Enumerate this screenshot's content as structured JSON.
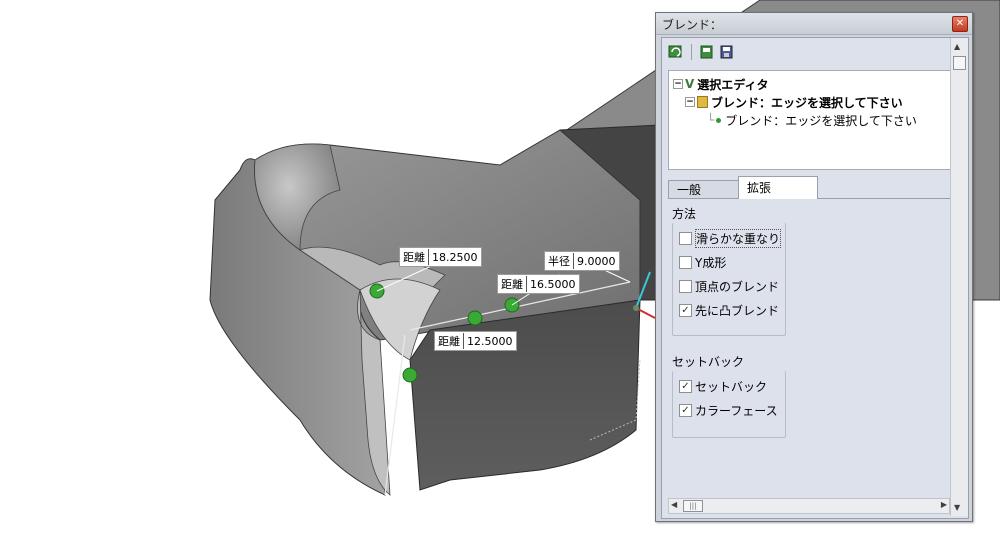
{
  "viewport": {
    "dimension_labels": [
      {
        "label": "距離",
        "value": "18.2500"
      },
      {
        "label": "半径",
        "value": "9.0000"
      },
      {
        "label": "距離",
        "value": "16.5000"
      },
      {
        "label": "距離",
        "value": "12.5000"
      }
    ]
  },
  "panel": {
    "title": "ブレンド：",
    "close_glyph": "✕",
    "toolbar": {
      "icons": [
        "refresh-icon",
        "new-icon",
        "save-icon"
      ]
    },
    "tree": {
      "root": {
        "label": "選択エディタ",
        "icon": "selection-editor-icon"
      },
      "child": {
        "label": "ブレンド：エッジを選択して下さい",
        "icon": "blend-folder-icon"
      },
      "leaf": {
        "label": "ブレンド：エッジを選択して下さい",
        "icon": "green-dot-icon"
      }
    },
    "tabs": [
      "一般",
      "拡張"
    ],
    "active_tab": "拡張",
    "method_group": {
      "title": "方法",
      "options": [
        {
          "label": "滑らかな重なり",
          "checked": false
        },
        {
          "label": "Y成形",
          "checked": false
        },
        {
          "label": "頂点のブレンド",
          "checked": false
        },
        {
          "label": "先に凸ブレンド",
          "checked": true
        }
      ]
    },
    "setback_group": {
      "title": "セットバック",
      "options": [
        {
          "label": "セットバック",
          "checked": true
        },
        {
          "label": "カラーフェース",
          "checked": true
        }
      ]
    },
    "scroll": {
      "hthumb_glyph": "|||"
    },
    "colors": {
      "panel_bg": "#dde1ec",
      "accent_green": "#3ba935",
      "close_red": "#d2482f"
    }
  }
}
